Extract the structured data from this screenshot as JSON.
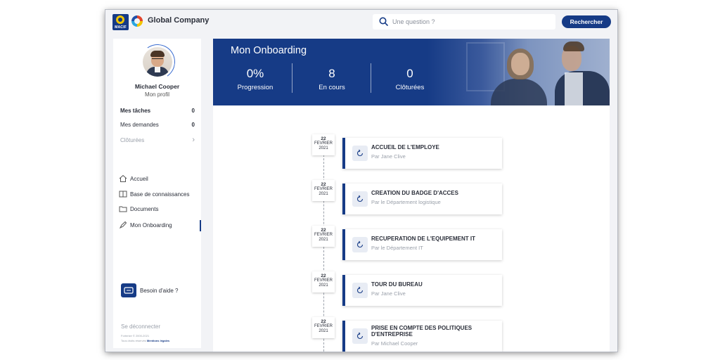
{
  "header": {
    "logo_text": "MACIF",
    "company_name": "Global Company",
    "search_placeholder": "Une question ?",
    "search_button": "Rechercher"
  },
  "sidebar": {
    "user_name": "Michael Cooper",
    "profile_link": "Mon profil",
    "tasks": [
      {
        "label": "Mes tâches",
        "count": "0"
      },
      {
        "label": "Mes demandes",
        "count": "0"
      },
      {
        "label": "Clôturées"
      }
    ],
    "nav": [
      {
        "label": "Accueil",
        "icon": "home-icon"
      },
      {
        "label": "Base de connaissances",
        "icon": "book-icon"
      },
      {
        "label": "Documents",
        "icon": "folder-icon"
      },
      {
        "label": "Mon Onboarding",
        "icon": "rocket-icon"
      }
    ],
    "help": "Besoin d'aide ?",
    "logout": "Se déconnecter",
    "legal_line1": "Forterize © 2000-2021",
    "legal_line2": "Tous droits réservés",
    "legal_link": "Mentions légales"
  },
  "banner": {
    "title": "Mon Onboarding",
    "stats": [
      {
        "value": "0%",
        "label": "Progression"
      },
      {
        "value": "8",
        "label": "En cours"
      },
      {
        "value": "0",
        "label": "Clôturées"
      }
    ]
  },
  "timeline": [
    {
      "day": "22",
      "month": "FEVRIER",
      "year": "2021",
      "title": "ACCUEIL DE L'EMPLOYE",
      "by": "Par Jane Clive"
    },
    {
      "day": "22",
      "month": "FEVRIER",
      "year": "2021",
      "title": "CREATION DU BADGE D'ACCES",
      "by": "Par le Département logistique"
    },
    {
      "day": "22",
      "month": "FEVRIER",
      "year": "2021",
      "title": "RECUPERATION DE L'EQUIPEMENT IT",
      "by": "Par le Département IT"
    },
    {
      "day": "22",
      "month": "FEVRIER",
      "year": "2021",
      "title": "TOUR DU BUREAU",
      "by": "Par Jane Clive"
    },
    {
      "day": "22",
      "month": "FEVRIER",
      "year": "2021",
      "title": "PRISE EN COMPTE DES POLITIQUES D'ENTREPRISE",
      "by": "Par Michael Cooper"
    }
  ],
  "colors": {
    "primary": "#163b86",
    "background": "#f2f3f6",
    "muted": "#9aa0aa"
  }
}
